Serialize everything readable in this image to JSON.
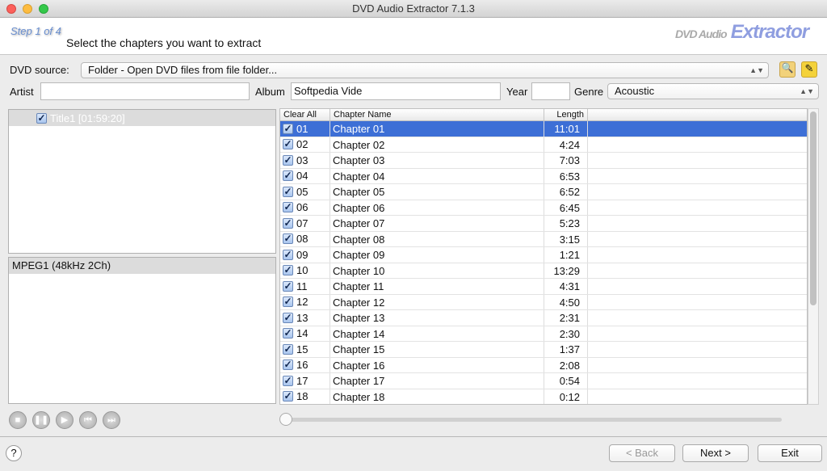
{
  "window": {
    "title": "DVD Audio Extractor 7.1.3"
  },
  "header": {
    "step": "Step 1 of 4",
    "subtitle": "Select the chapters you want to extract",
    "logo_top": "DVD Audio",
    "logo_bottom": "Extractor"
  },
  "source": {
    "label": "DVD source:",
    "value": "Folder - Open DVD files from file folder..."
  },
  "meta": {
    "artist_label": "Artist",
    "artist_value": "",
    "album_label": "Album",
    "album_value": "Softpedia Vide",
    "year_label": "Year",
    "year_value": "",
    "genre_label": "Genre",
    "genre_value": "Acoustic"
  },
  "titles": [
    {
      "label": "Title1 [01:59:20]",
      "checked": true
    }
  ],
  "audio_streams": [
    "MPEG1 (48kHz 2Ch)"
  ],
  "table": {
    "headers": {
      "check": "Clear All",
      "name": "Chapter Name",
      "length": "Length"
    },
    "rows": [
      {
        "num": "01",
        "name": "Chapter 01",
        "length": "11:01"
      },
      {
        "num": "02",
        "name": "Chapter 02",
        "length": "4:24"
      },
      {
        "num": "03",
        "name": "Chapter 03",
        "length": "7:03"
      },
      {
        "num": "04",
        "name": "Chapter 04",
        "length": "6:53"
      },
      {
        "num": "05",
        "name": "Chapter 05",
        "length": "6:52"
      },
      {
        "num": "06",
        "name": "Chapter 06",
        "length": "6:45"
      },
      {
        "num": "07",
        "name": "Chapter 07",
        "length": "5:23"
      },
      {
        "num": "08",
        "name": "Chapter 08",
        "length": "3:15"
      },
      {
        "num": "09",
        "name": "Chapter 09",
        "length": "1:21"
      },
      {
        "num": "10",
        "name": "Chapter 10",
        "length": "13:29"
      },
      {
        "num": "11",
        "name": "Chapter 11",
        "length": "4:31"
      },
      {
        "num": "12",
        "name": "Chapter 12",
        "length": "4:50"
      },
      {
        "num": "13",
        "name": "Chapter 13",
        "length": "2:31"
      },
      {
        "num": "14",
        "name": "Chapter 14",
        "length": "2:30"
      },
      {
        "num": "15",
        "name": "Chapter 15",
        "length": "1:37"
      },
      {
        "num": "16",
        "name": "Chapter 16",
        "length": "2:08"
      },
      {
        "num": "17",
        "name": "Chapter 17",
        "length": "0:54"
      },
      {
        "num": "18",
        "name": "Chapter 18",
        "length": "0:12"
      }
    ]
  },
  "player": {
    "position_percent": 0
  },
  "footer": {
    "help": "?",
    "back": "< Back",
    "next": "Next >",
    "exit": "Exit"
  },
  "colors": {
    "selection": "#3d6fd6",
    "accent": "#6a8fd0"
  }
}
